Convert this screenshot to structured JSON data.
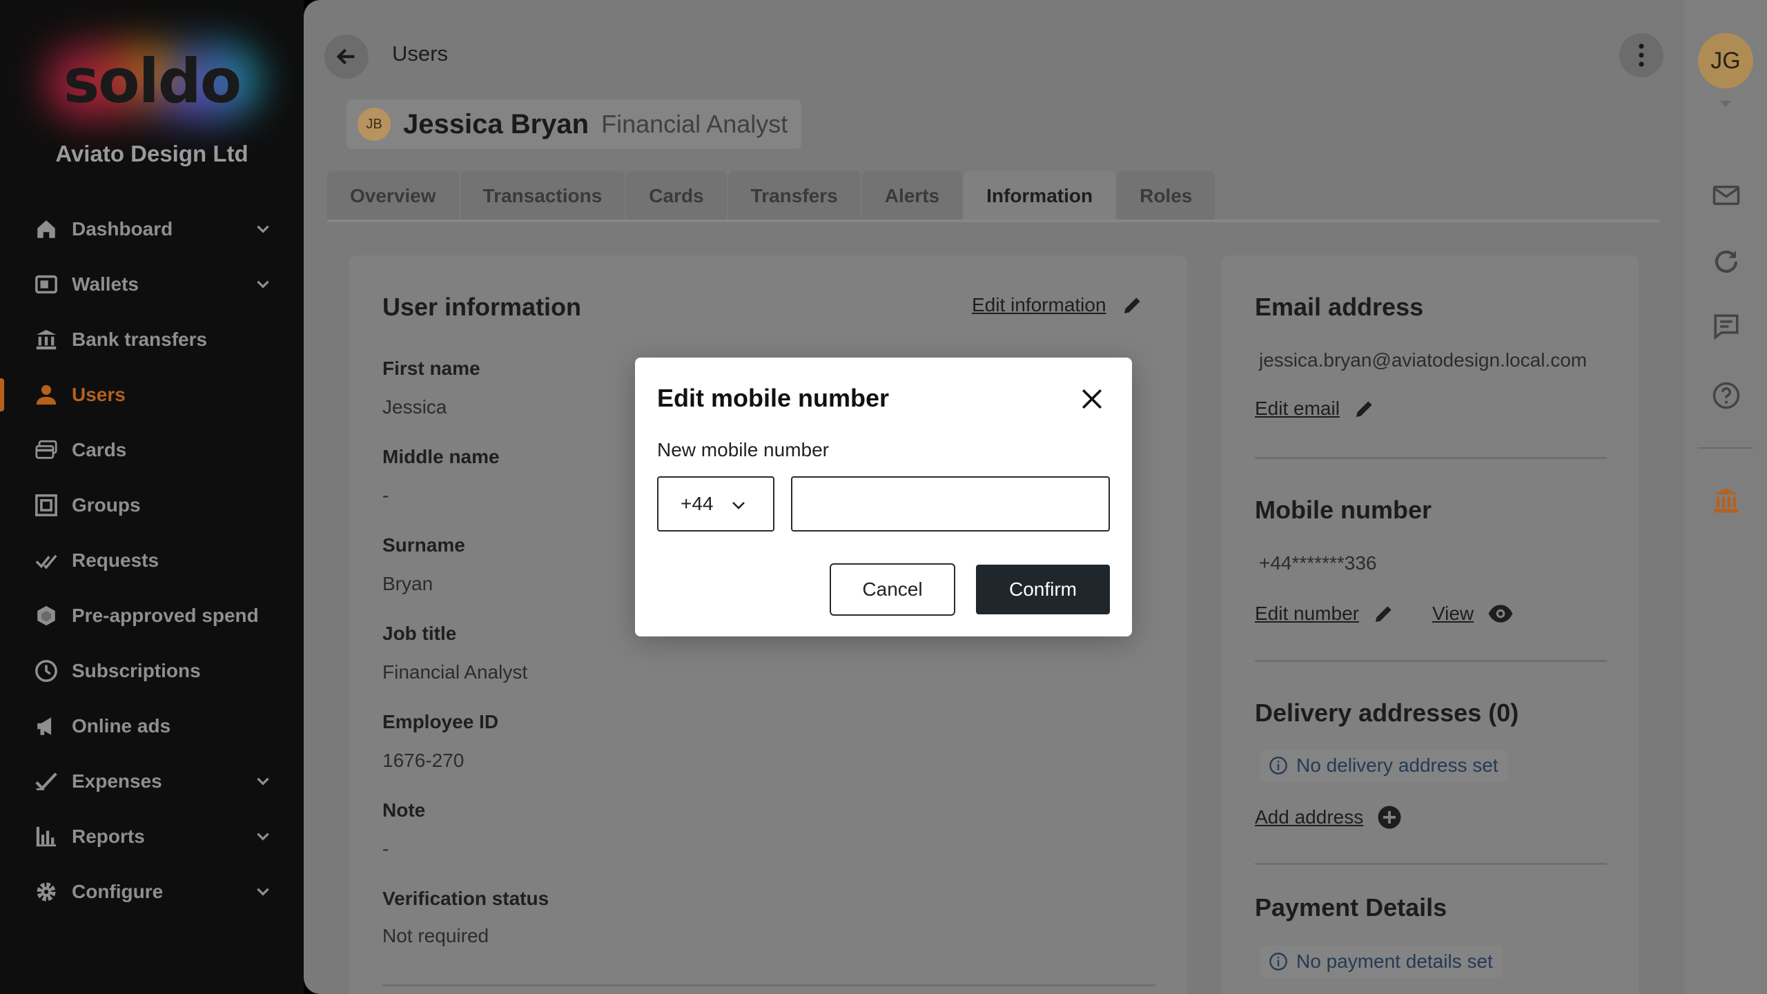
{
  "sidebar": {
    "logo_text": "soldo",
    "company": "Aviato Design Ltd",
    "items": [
      {
        "label": "Dashboard",
        "icon": "home-icon",
        "chevron": true
      },
      {
        "label": "Wallets",
        "icon": "wallet-icon",
        "chevron": true
      },
      {
        "label": "Bank transfers",
        "icon": "bank-transfer-icon",
        "chevron": false
      },
      {
        "label": "Users",
        "icon": "user-icon",
        "chevron": false,
        "active": true
      },
      {
        "label": "Cards",
        "icon": "cards-icon",
        "chevron": false
      },
      {
        "label": "Groups",
        "icon": "groups-icon",
        "chevron": false
      },
      {
        "label": "Requests",
        "icon": "requests-icon",
        "chevron": false
      },
      {
        "label": "Pre-approved spend",
        "icon": "pre-approved-icon",
        "chevron": false
      },
      {
        "label": "Subscriptions",
        "icon": "clock-icon",
        "chevron": false
      },
      {
        "label": "Online ads",
        "icon": "megaphone-icon",
        "chevron": false
      },
      {
        "label": "Expenses",
        "icon": "expenses-icon",
        "chevron": true
      },
      {
        "label": "Reports",
        "icon": "reports-icon",
        "chevron": true
      },
      {
        "label": "Configure",
        "icon": "gear-icon",
        "chevron": true
      }
    ]
  },
  "header": {
    "breadcrumb": "Users",
    "user_initials": "JB",
    "user_name": "Jessica Bryan",
    "user_role": "Financial Analyst"
  },
  "tabs": [
    "Overview",
    "Transactions",
    "Cards",
    "Transfers",
    "Alerts",
    "Information",
    "Roles"
  ],
  "active_tab": "Information",
  "user_info": {
    "title": "User information",
    "edit_label": "Edit information",
    "fields": [
      {
        "label": "First name",
        "value": "Jessica"
      },
      {
        "label": "Middle name",
        "value": "-"
      },
      {
        "label": "Surname",
        "value": "Bryan"
      },
      {
        "label": "Job title",
        "value": "Financial Analyst"
      },
      {
        "label": "Employee ID",
        "value": "1676-270"
      },
      {
        "label": "Note",
        "value": "-"
      },
      {
        "label": "Verification status",
        "value": "Not required"
      }
    ]
  },
  "contact": {
    "email_title": "Email address",
    "email": "jessica.bryan@aviatodesign.local.com",
    "edit_email": "Edit email",
    "mobile_title": "Mobile number",
    "mobile": "+44*******336",
    "edit_number": "Edit number",
    "view": "View",
    "delivery_title": "Delivery addresses (0)",
    "delivery_empty": "No delivery address set",
    "add_address": "Add address",
    "payment_title": "Payment Details",
    "payment_empty": "No payment details set"
  },
  "right_bar": {
    "avatar_initials": "JG",
    "icons": [
      "mail-icon",
      "refresh-icon",
      "chat-icon",
      "help-icon",
      "bank-icon"
    ]
  },
  "modal": {
    "title": "Edit mobile number",
    "field_label": "New mobile number",
    "country_code": "+44",
    "phone_value": "",
    "cancel": "Cancel",
    "confirm": "Confirm"
  },
  "colors": {
    "accent": "#b5611e",
    "confirm_button": "#1f262c",
    "info_text": "#253a55"
  }
}
